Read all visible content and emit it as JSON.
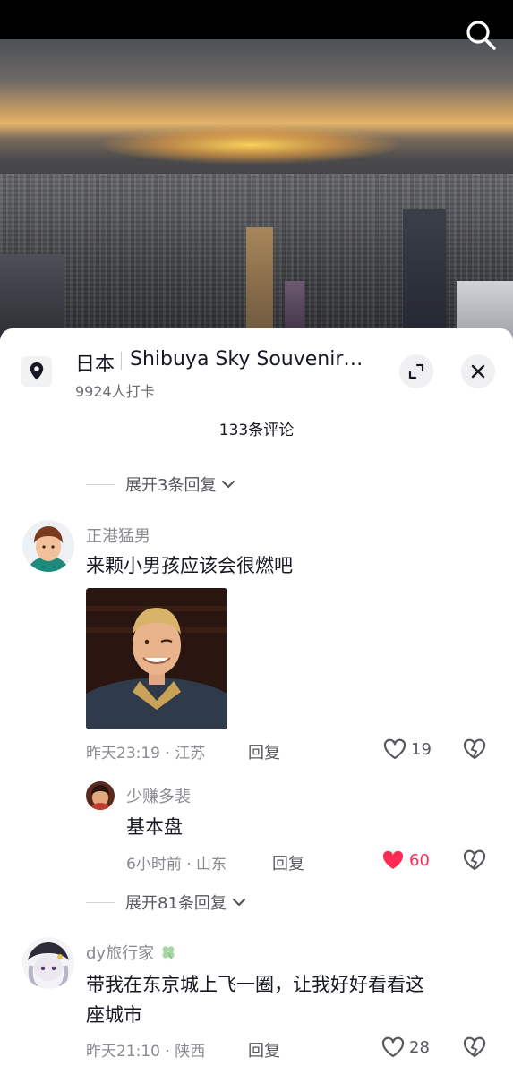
{
  "colors": {
    "accent": "#fe2c55",
    "text_primary": "#161823",
    "text_secondary": "#8a8b91"
  },
  "location": {
    "country": "日本",
    "name": "Shibuya Sky Souvenir…",
    "checkins": "9924人打卡"
  },
  "comments_header": {
    "count_label": "133条评论"
  },
  "expand_top": {
    "label": "展开3条回复"
  },
  "comments": [
    {
      "username": "正港猛男",
      "text": "来颗小男孩应该会很燃吧",
      "time": "昨天23:19 · 江苏",
      "reply_label": "回复",
      "likes": "19",
      "liked": false
    },
    {
      "username": "dy旅行家",
      "username_badge_icon": "four-leaf-clover-icon",
      "text_line1": "带我在东京城上飞一圈，让我好好看看这",
      "text_line2": "座城市",
      "time": "昨天21:10 · 陕西",
      "reply_label": "回复",
      "likes": "28",
      "liked": false
    }
  ],
  "replies": [
    {
      "username": "少赚多裴",
      "text": "基本盘",
      "time": "6小时前 · 山东",
      "reply_label": "回复",
      "likes": "60",
      "liked": true
    }
  ],
  "expand_mid": {
    "label": "展开81条回复"
  },
  "icons": {
    "search": "search-icon",
    "location": "location-pin-icon",
    "expand": "expand-icon",
    "close": "close-icon",
    "like": "heart-icon",
    "dislike": "broken-heart-icon",
    "chevron": "chevron-down-icon"
  }
}
